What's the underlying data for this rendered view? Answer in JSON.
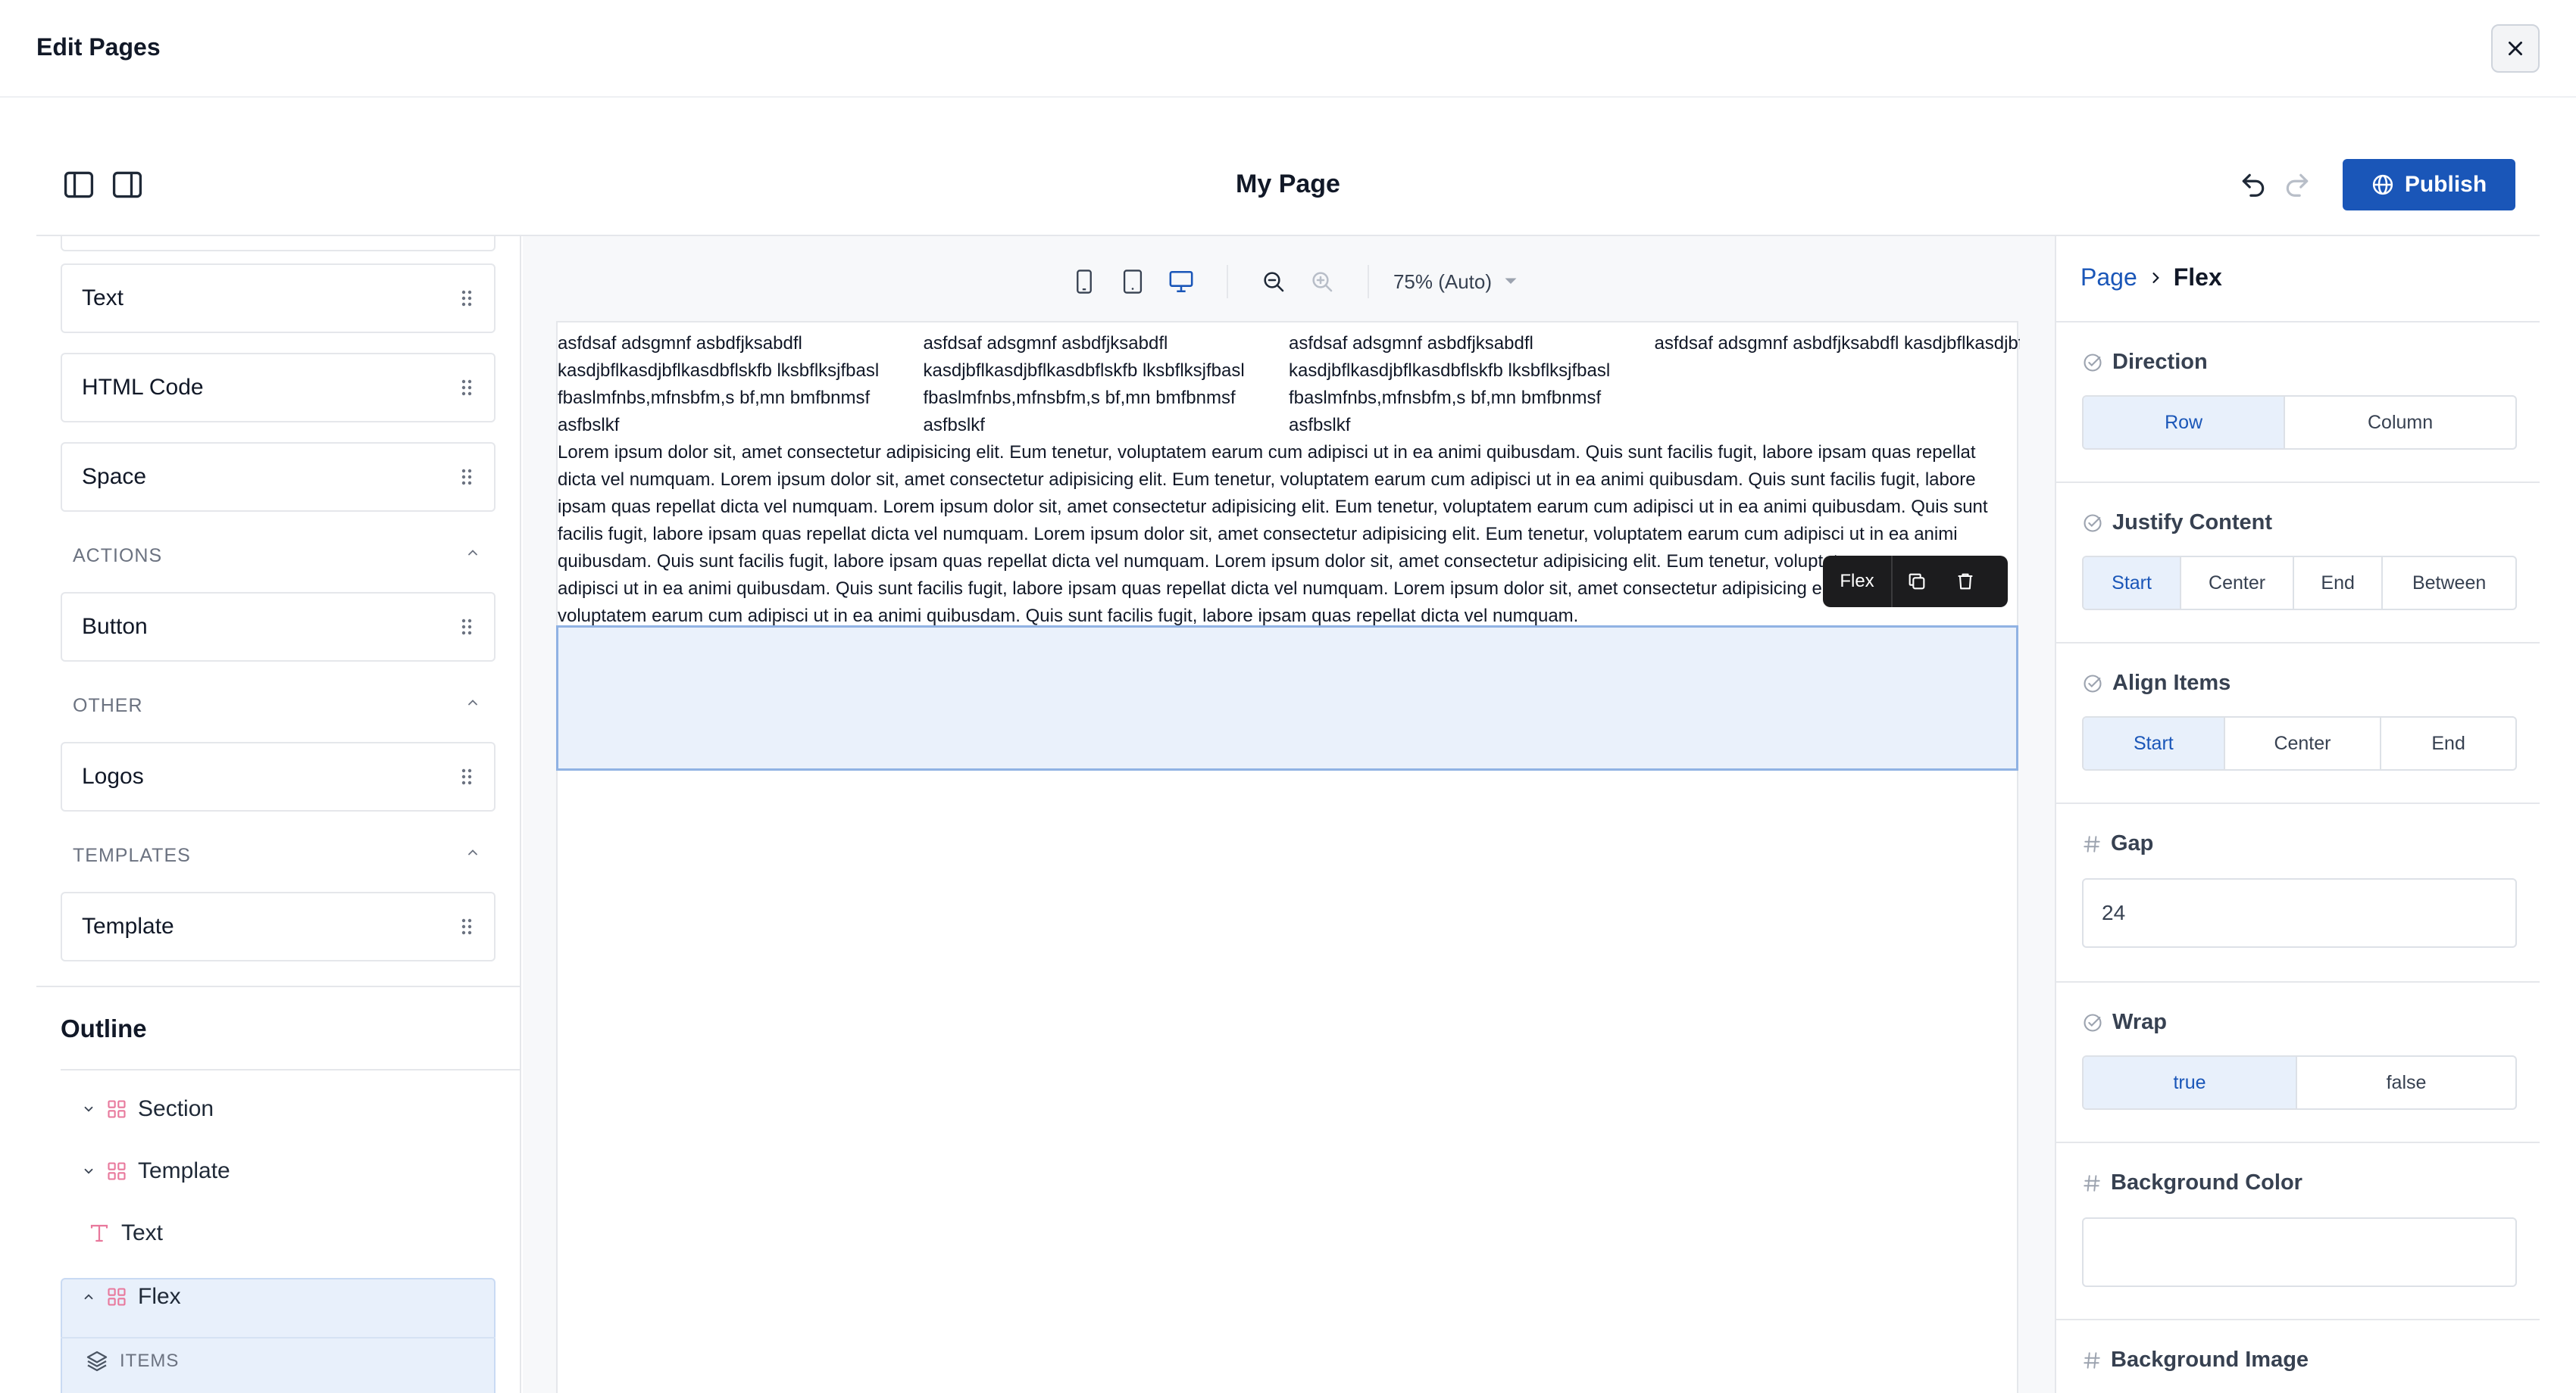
{
  "modal": {
    "title": "Edit Pages"
  },
  "header": {
    "page_name": "My Page",
    "publish_label": "Publish"
  },
  "blocks": {
    "text": "Text",
    "html_code": "HTML Code",
    "space": "Space",
    "actions_heading": "ACTIONS",
    "button": "Button",
    "other_heading": "OTHER",
    "logos": "Logos",
    "templates_heading": "TEMPLATES",
    "template": "Template"
  },
  "outline": {
    "title": "Outline",
    "items": [
      "Section",
      "Template",
      "Text",
      "Flex"
    ],
    "items_label": "ITEMS"
  },
  "canvas": {
    "zoom": "75% (Auto)",
    "column_text": "asfdsaf adsgmnf asbdfjksabdfl kasdjbflkasdjbflkasdbflskfb lksbflksjfbasl fbaslmfnbs,mfnsbfm,s bf,mn bmfbnmsf asfbslkf",
    "paragraph": "Lorem ipsum dolor sit, amet consectetur adipisicing elit. Eum tenetur, voluptatem earum cum adipisci ut in ea animi quibusdam. Quis sunt facilis fugit, labore ipsam quas repellat dicta vel numquam. Lorem ipsum dolor sit, amet consectetur adipisicing elit. Eum tenetur, voluptatem earum cum adipisci ut in ea animi quibusdam. Quis sunt facilis fugit, labore ipsam quas repellat dicta vel numquam. Lorem ipsum dolor sit, amet consectetur adipisicing elit. Eum tenetur, voluptatem earum cum adipisci ut in ea animi quibusdam. Quis sunt facilis fugit, labore ipsam quas repellat dicta vel numquam. Lorem ipsum dolor sit, amet consectetur adipisicing elit. Eum tenetur, voluptatem earum cum adipisci ut in ea animi quibusdam. Quis sunt facilis fugit, labore ipsam quas repellat dicta vel numquam. Lorem ipsum dolor sit, amet consectetur adipisicing elit. Eum tenetur, voluptatem earum cum adipisci ut in ea animi quibusdam. Quis sunt facilis fugit, labore ipsam quas repellat dicta vel numquam. Lorem ipsum dolor sit, amet consectetur adipisicing elit. Eum tenetur, voluptatem earum cum adipisci ut in ea animi quibusdam. Quis sunt facilis fugit, labore ipsam quas repellat dicta vel numquam.",
    "selection_label": "Flex"
  },
  "props": {
    "crumb_parent": "Page",
    "crumb_current": "Flex",
    "direction": {
      "label": "Direction",
      "options": [
        "Row",
        "Column"
      ],
      "selected": "Row"
    },
    "justify": {
      "label": "Justify Content",
      "options": [
        "Start",
        "Center",
        "End",
        "Between"
      ],
      "selected": "Start"
    },
    "align": {
      "label": "Align Items",
      "options": [
        "Start",
        "Center",
        "End"
      ],
      "selected": "Start"
    },
    "gap": {
      "label": "Gap",
      "value": "24"
    },
    "wrap": {
      "label": "Wrap",
      "options": [
        "true",
        "false"
      ],
      "selected": "true"
    },
    "bg_color": {
      "label": "Background Color",
      "value": ""
    },
    "bg_image": {
      "label": "Background Image"
    }
  },
  "colors": {
    "accent": "#1a56b8",
    "selected_bg": "#e8f0fb",
    "outline_icon": "#e8789c"
  }
}
